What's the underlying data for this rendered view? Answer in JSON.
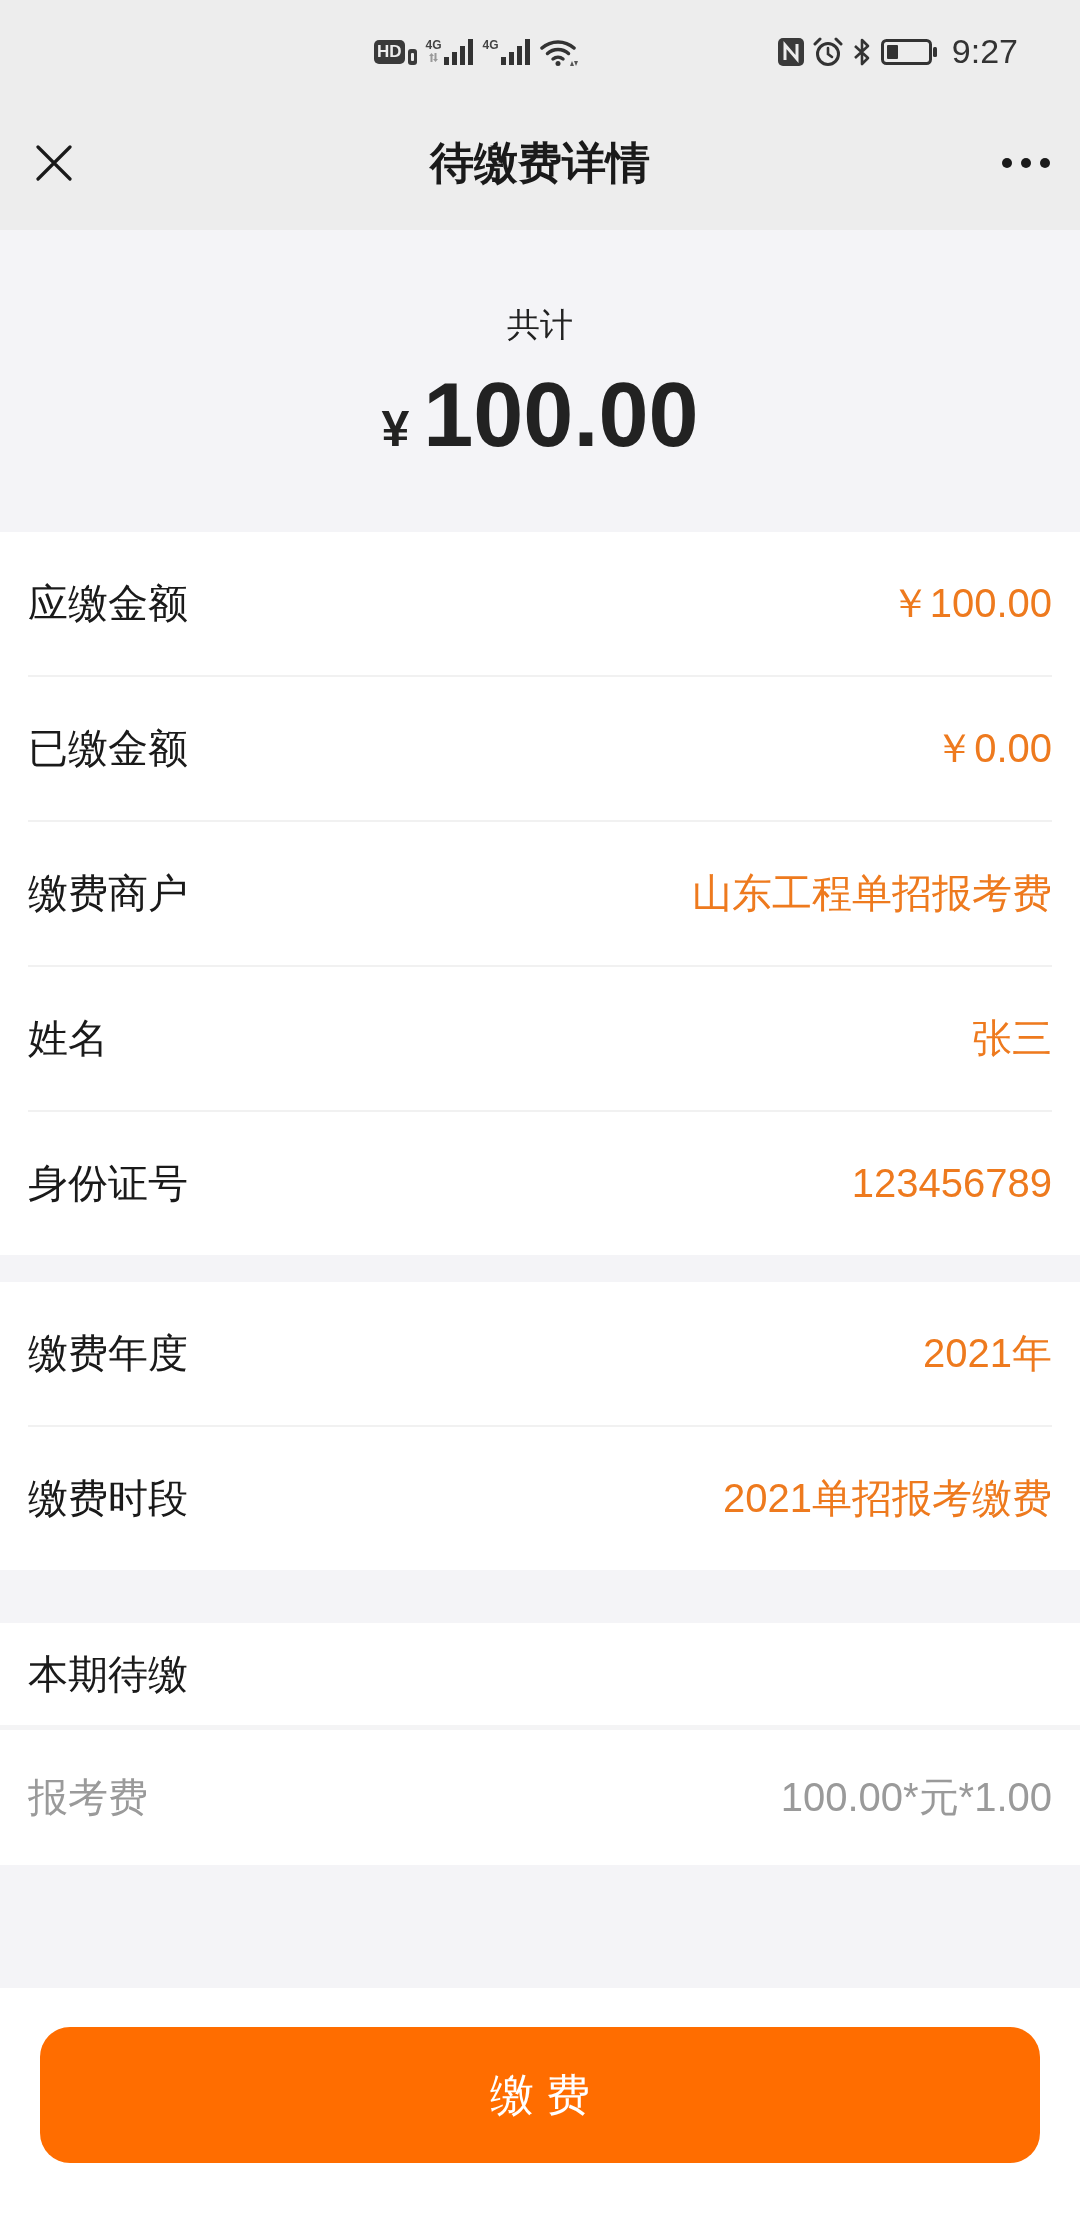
{
  "status_bar": {
    "network_badge": "HD",
    "signals": [
      {
        "label": "4G",
        "data_activity": true
      },
      {
        "label": "4G",
        "data_activity": false
      }
    ],
    "time": "9:27"
  },
  "header": {
    "title": "待缴费详情"
  },
  "summary": {
    "label": "共计",
    "currency": "¥",
    "amount": "100.00"
  },
  "sections": [
    {
      "rows": [
        {
          "kind": "field",
          "label": "应缴金额",
          "value": "￥100.00"
        },
        {
          "kind": "field",
          "label": "已缴金额",
          "value": "￥0.00"
        },
        {
          "kind": "field",
          "label": "缴费商户",
          "value": "山东工程单招报考费"
        },
        {
          "kind": "field",
          "label": "姓名",
          "value": "张三"
        },
        {
          "kind": "field",
          "label": "身份证号",
          "value": "123456789"
        }
      ]
    },
    {
      "rows": [
        {
          "kind": "field",
          "label": "缴费年度",
          "value": "2021年"
        },
        {
          "kind": "field",
          "label": "缴费时段",
          "value": "2021单招报考缴费"
        }
      ]
    },
    {
      "rows": [
        {
          "kind": "heading",
          "label": "本期待缴"
        },
        {
          "kind": "item",
          "label": "报考费",
          "value": "100.00*元*1.00"
        }
      ]
    }
  ],
  "pay_button": {
    "label": "缴 费"
  }
}
